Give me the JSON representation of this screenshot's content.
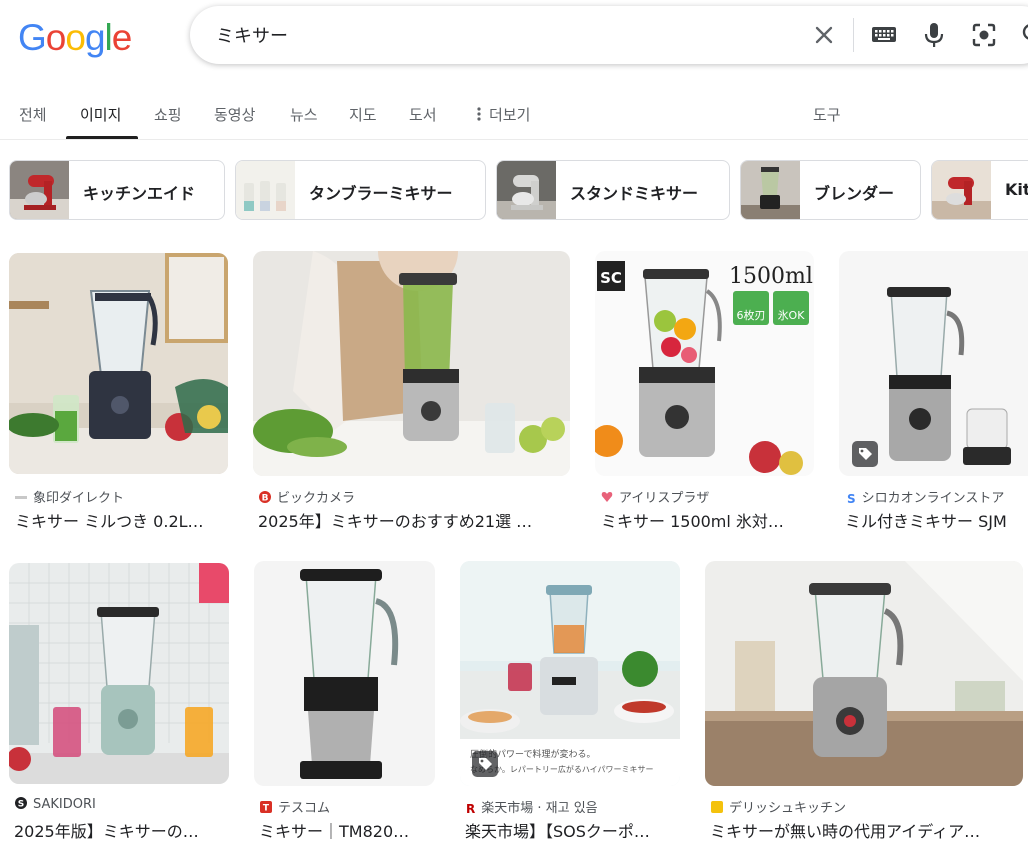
{
  "header": {
    "logo_letters": [
      "G",
      "o",
      "o",
      "g",
      "l",
      "e"
    ],
    "logo_colors": [
      "#4285F4",
      "#EA4335",
      "#FBBC05",
      "#4285F4",
      "#34A853",
      "#EA4335"
    ],
    "query": "ミキサー"
  },
  "tabs": [
    {
      "label": "전체"
    },
    {
      "label": "이미지"
    },
    {
      "label": "쇼핑"
    },
    {
      "label": "동영상"
    },
    {
      "label": "뉴스"
    },
    {
      "label": "지도"
    },
    {
      "label": "도서"
    },
    {
      "label": "더보기"
    },
    {
      "label": "도구"
    }
  ],
  "chips": [
    {
      "label": "キッチンエイド"
    },
    {
      "label": "タンブラーミキサー"
    },
    {
      "label": "スタンドミキサー"
    },
    {
      "label": "ブレンダー"
    },
    {
      "label": "Kitc"
    }
  ],
  "results": [
    {
      "source": "象印ダイレクト",
      "title": "ミキサー ミルつき 0.2L…"
    },
    {
      "source": "ビックカメラ",
      "title": "2025年】ミキサーのおすすめ21選 …"
    },
    {
      "source": "アイリスプラザ",
      "title": "ミキサー 1500ml 氷対…",
      "overlay_big": "1500ml",
      "overlay_logo": "SC",
      "overlay_b1": "6枚刃",
      "overlay_b2": "氷OK"
    },
    {
      "source": "シロカオンラインストア",
      "title": "ミル付きミキサー SJM"
    },
    {
      "source": "SAKIDORI",
      "title": "2025年版】ミキサーの…"
    },
    {
      "source": "テスコム",
      "title": "ミキサー｜TM820…"
    },
    {
      "source": "楽天市場 · 재고 있음",
      "title": "楽天市場】【SOSクーポ…",
      "caption1": "圧倒的パワーで料理が変わる。",
      "caption2": "なめらか。レパートリー広がるハイパワーミキサー"
    },
    {
      "source": "デリッシュキッチン",
      "title": "ミキサーが無い時の代用アイディア…"
    }
  ],
  "colors": {
    "source_icon_1": "#c8c8c8",
    "source_icon_2": "#d93025",
    "source_icon_3": "#e8627a",
    "source_icon_4": "#4285F4",
    "source_icon_5": "#202124",
    "source_icon_6": "#d93025",
    "source_icon_7": "#bf0000",
    "source_icon_8": "#f4c20d"
  }
}
